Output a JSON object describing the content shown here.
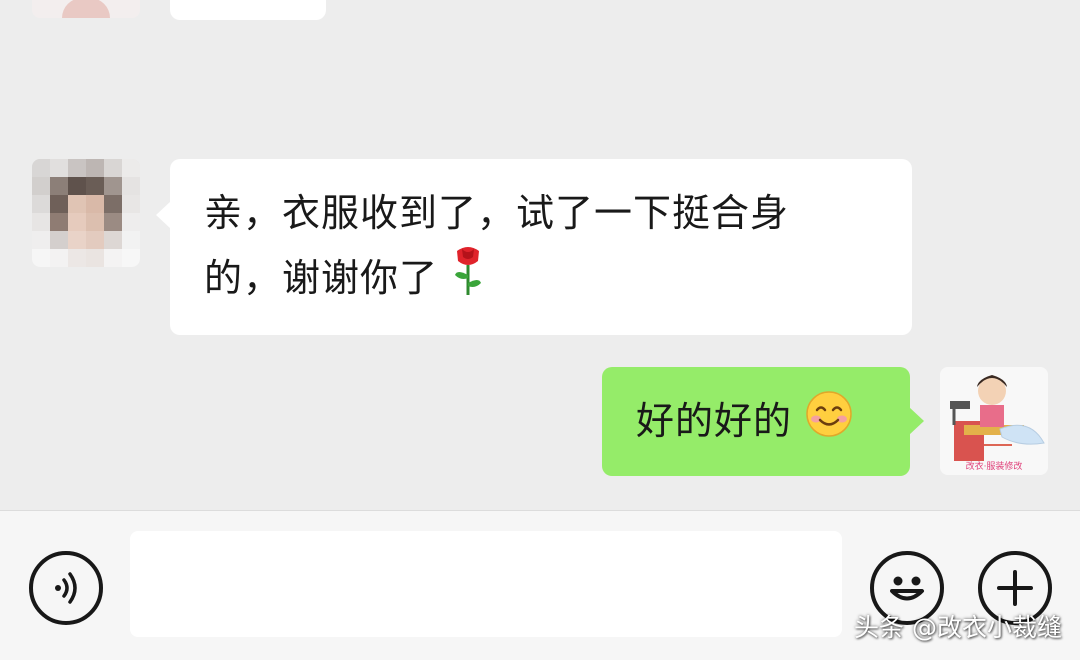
{
  "messages": [
    {
      "direction": "incoming",
      "line1": "亲，衣服收到了，试了一下挺合身",
      "line2": "的，谢谢你了",
      "emoji": "rose-icon"
    },
    {
      "direction": "outgoing",
      "text": "好的好的",
      "emoji": "smile-icon"
    }
  ],
  "avatar_caption": "改衣·服装修改",
  "input_bar": {
    "placeholder": "",
    "voice_icon": "voice-icon",
    "emoji_icon": "emoji-face-icon",
    "plus_icon": "plus-icon"
  },
  "watermark": "头条 @改衣小裁缝",
  "colors": {
    "background": "#ededed",
    "incoming_bubble": "#ffffff",
    "outgoing_bubble": "#95ec69",
    "input_bar": "#f6f6f6"
  }
}
